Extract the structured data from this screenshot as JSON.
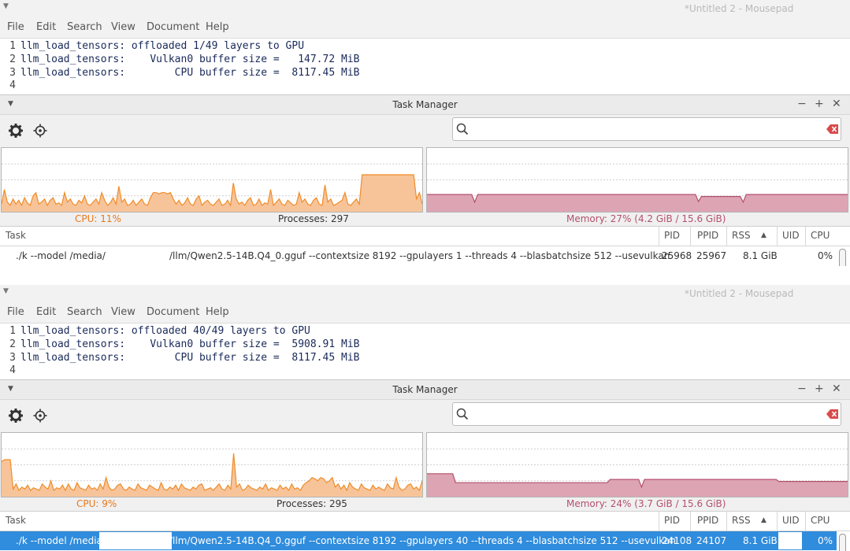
{
  "panels": [
    {
      "mousepad": {
        "title": "*Untitled 2 - Mousepad",
        "menu": [
          "File",
          "Edit",
          "Search",
          "View",
          "Document",
          "Help"
        ],
        "lines": [
          {
            "n": "1",
            "text": "llm_load_tensors: offloaded 1/49 layers to GPU"
          },
          {
            "n": "2",
            "text": "llm_load_tensors:    Vulkan0 buffer size =   147.72 MiB"
          },
          {
            "n": "3",
            "text": "llm_load_tensors:        CPU buffer size =  8117.45 MiB"
          },
          {
            "n": "4",
            "text": ""
          }
        ]
      },
      "taskmanager": {
        "title": "Task Manager",
        "search_value": "",
        "cpu_label": "CPU: 11%",
        "processes_label": "Processes: 297",
        "memory_label": "Memory: 27% (4.2 GiB / 15.6 GiB)",
        "columns": {
          "task": "Task",
          "pid": "PID",
          "ppid": "PPID",
          "rss": "RSS",
          "uid": "UID",
          "cpu": "CPU"
        },
        "row": {
          "task_a": "./k --model /media/",
          "task_b": "/llm/Qwen2.5-14B.Q4_0.gguf --contextsize 8192 --gpulayers 1 --threads 4 --blasbatchsize 512 --usevulkan",
          "pid": "25968",
          "ppid": "25967",
          "rss": "8.1 GiB",
          "uid": "",
          "cpu": "0%",
          "selected": false
        },
        "cpu_history": [
          0.12,
          0.35,
          0.15,
          0.1,
          0.2,
          0.12,
          0.18,
          0.1,
          0.22,
          0.14,
          0.1,
          0.25,
          0.3,
          0.12,
          0.15,
          0.2,
          0.1,
          0.18,
          0.22,
          0.12,
          0.14,
          0.1,
          0.3,
          0.15,
          0.2,
          0.12,
          0.1,
          0.18,
          0.14,
          0.25,
          0.12,
          0.1,
          0.15,
          0.2,
          0.12,
          0.3,
          0.18,
          0.1,
          0.14,
          0.22,
          0.12,
          0.4,
          0.15,
          0.2,
          0.1,
          0.12,
          0.18,
          0.1,
          0.15,
          0.2,
          0.12,
          0.1,
          0.22,
          0.3,
          0.3,
          0.28,
          0.3,
          0.3,
          0.28,
          0.3,
          0.2,
          0.12,
          0.18,
          0.1,
          0.14,
          0.22,
          0.12,
          0.1,
          0.2,
          0.25,
          0.1,
          0.15,
          0.18,
          0.12,
          0.1,
          0.15,
          0.2,
          0.1,
          0.12,
          0.18,
          0.1,
          0.45,
          0.2,
          0.12,
          0.15,
          0.1,
          0.18,
          0.22,
          0.1,
          0.12,
          0.2,
          0.1,
          0.14,
          0.12,
          0.35,
          0.1,
          0.15,
          0.2,
          0.12,
          0.1,
          0.18,
          0.14,
          0.1,
          0.12,
          0.3,
          0.15,
          0.2,
          0.12,
          0.1,
          0.18,
          0.22,
          0.12,
          0.1,
          0.42,
          0.15,
          0.2,
          0.1,
          0.12,
          0.15,
          0.18,
          0.3,
          0.12,
          0.1,
          0.15,
          0.2,
          0.12,
          0.58,
          0.58,
          0.58,
          0.58,
          0.58,
          0.58,
          0.58,
          0.58,
          0.58,
          0.58,
          0.58,
          0.58,
          0.58,
          0.58,
          0.58,
          0.58,
          0.58,
          0.58,
          0.58,
          0.2,
          0.3,
          0.12
        ],
        "mem_history": [
          0.27,
          0.27,
          0.27,
          0.27,
          0.27,
          0.27,
          0.27,
          0.27,
          0.27,
          0.27,
          0.27,
          0.27,
          0.27,
          0.27,
          0.27,
          0.27,
          0.15,
          0.27,
          0.27,
          0.27,
          0.27,
          0.27,
          0.27,
          0.27,
          0.27,
          0.27,
          0.27,
          0.27,
          0.27,
          0.27,
          0.27,
          0.27,
          0.27,
          0.27,
          0.27,
          0.27,
          0.27,
          0.27,
          0.27,
          0.27,
          0.27,
          0.27,
          0.27,
          0.27,
          0.27,
          0.27,
          0.27,
          0.27,
          0.27,
          0.27,
          0.27,
          0.27,
          0.27,
          0.27,
          0.27,
          0.27,
          0.27,
          0.27,
          0.27,
          0.27,
          0.27,
          0.27,
          0.27,
          0.27,
          0.27,
          0.27,
          0.27,
          0.27,
          0.27,
          0.27,
          0.27,
          0.27,
          0.27,
          0.27,
          0.27,
          0.27,
          0.27,
          0.27,
          0.27,
          0.27,
          0.27,
          0.27,
          0.27,
          0.27,
          0.27,
          0.27,
          0.27,
          0.27,
          0.27,
          0.27,
          0.27,
          0.16,
          0.24,
          0.24,
          0.24,
          0.24,
          0.24,
          0.24,
          0.24,
          0.24,
          0.24,
          0.24,
          0.24,
          0.24,
          0.24,
          0.24,
          0.15,
          0.27,
          0.27,
          0.27,
          0.27,
          0.27,
          0.27,
          0.27,
          0.27,
          0.27,
          0.27,
          0.27,
          0.27,
          0.27,
          0.27,
          0.27,
          0.27,
          0.27,
          0.27,
          0.27,
          0.27,
          0.27,
          0.27,
          0.27,
          0.27,
          0.27,
          0.27,
          0.27,
          0.27,
          0.27,
          0.27,
          0.27,
          0.27,
          0.27,
          0.27,
          0.27
        ]
      }
    },
    {
      "mousepad": {
        "title": "*Untitled 2 - Mousepad",
        "menu": [
          "File",
          "Edit",
          "Search",
          "View",
          "Document",
          "Help"
        ],
        "lines": [
          {
            "n": "1",
            "text": "llm_load_tensors: offloaded 40/49 layers to GPU"
          },
          {
            "n": "2",
            "text": "llm_load_tensors:    Vulkan0 buffer size =  5908.91 MiB"
          },
          {
            "n": "3",
            "text": "llm_load_tensors:        CPU buffer size =  8117.45 MiB"
          },
          {
            "n": "4",
            "text": ""
          }
        ]
      },
      "taskmanager": {
        "title": "Task Manager",
        "search_value": "",
        "cpu_label": "CPU: 9%",
        "processes_label": "Processes: 295",
        "memory_label": "Memory: 24% (3.7 GiB / 15.6 GiB)",
        "columns": {
          "task": "Task",
          "pid": "PID",
          "ppid": "PPID",
          "rss": "RSS",
          "uid": "UID",
          "cpu": "CPU"
        },
        "row": {
          "task_a": "./k --model /media/",
          "task_b": "/llm/Qwen2.5-14B.Q4_0.gguf --contextsize 8192 --gpulayers 40 --threads 4 --blasbatchsize 512 --usevulkan",
          "pid": "24108",
          "ppid": "24107",
          "rss": "8.1 GiB",
          "uid": "",
          "cpu": "0%",
          "selected": true
        },
        "cpu_history": [
          0.55,
          0.58,
          0.58,
          0.58,
          0.12,
          0.2,
          0.1,
          0.15,
          0.12,
          0.18,
          0.1,
          0.14,
          0.12,
          0.1,
          0.2,
          0.15,
          0.12,
          0.25,
          0.1,
          0.14,
          0.12,
          0.18,
          0.1,
          0.2,
          0.12,
          0.1,
          0.22,
          0.14,
          0.12,
          0.1,
          0.18,
          0.12,
          0.14,
          0.1,
          0.2,
          0.12,
          0.3,
          0.15,
          0.1,
          0.12,
          0.18,
          0.2,
          0.12,
          0.1,
          0.15,
          0.12,
          0.1,
          0.2,
          0.14,
          0.12,
          0.1,
          0.18,
          0.15,
          0.12,
          0.1,
          0.22,
          0.12,
          0.1,
          0.15,
          0.12,
          0.18,
          0.1,
          0.2,
          0.14,
          0.12,
          0.1,
          0.15,
          0.12,
          0.18,
          0.2,
          0.1,
          0.12,
          0.14,
          0.1,
          0.15,
          0.2,
          0.12,
          0.1,
          0.18,
          0.12,
          0.68,
          0.15,
          0.2,
          0.1,
          0.12,
          0.18,
          0.14,
          0.12,
          0.1,
          0.15,
          0.12,
          0.2,
          0.1,
          0.14,
          0.12,
          0.1,
          0.18,
          0.12,
          0.15,
          0.1,
          0.2,
          0.12,
          0.14,
          0.1,
          0.18,
          0.22,
          0.25,
          0.3,
          0.28,
          0.25,
          0.3,
          0.28,
          0.22,
          0.25,
          0.3,
          0.15,
          0.2,
          0.12,
          0.18,
          0.1,
          0.22,
          0.15,
          0.12,
          0.1,
          0.2,
          0.14,
          0.12,
          0.1,
          0.18,
          0.12,
          0.15,
          0.12,
          0.1,
          0.2,
          0.14,
          0.12,
          0.3,
          0.15,
          0.1,
          0.12,
          0.18,
          0.2,
          0.12,
          0.15,
          0.1,
          0.25
        ],
        "mem_history": [
          0.36,
          0.36,
          0.36,
          0.36,
          0.36,
          0.36,
          0.36,
          0.36,
          0.36,
          0.36,
          0.22,
          0.22,
          0.22,
          0.22,
          0.22,
          0.22,
          0.22,
          0.22,
          0.22,
          0.22,
          0.22,
          0.22,
          0.22,
          0.22,
          0.22,
          0.22,
          0.22,
          0.22,
          0.22,
          0.22,
          0.22,
          0.22,
          0.22,
          0.22,
          0.22,
          0.22,
          0.22,
          0.22,
          0.22,
          0.22,
          0.22,
          0.22,
          0.22,
          0.22,
          0.22,
          0.22,
          0.22,
          0.22,
          0.22,
          0.22,
          0.22,
          0.22,
          0.22,
          0.22,
          0.22,
          0.22,
          0.22,
          0.22,
          0.22,
          0.22,
          0.22,
          0.22,
          0.22,
          0.22,
          0.27,
          0.27,
          0.27,
          0.27,
          0.27,
          0.27,
          0.27,
          0.27,
          0.27,
          0.27,
          0.27,
          0.15,
          0.27,
          0.27,
          0.27,
          0.27,
          0.27,
          0.27,
          0.27,
          0.27,
          0.27,
          0.27,
          0.27,
          0.27,
          0.27,
          0.27,
          0.27,
          0.27,
          0.27,
          0.27,
          0.27,
          0.27,
          0.27,
          0.27,
          0.27,
          0.27,
          0.27,
          0.27,
          0.27,
          0.27,
          0.27,
          0.27,
          0.27,
          0.27,
          0.27,
          0.27,
          0.27,
          0.27,
          0.27,
          0.27,
          0.27,
          0.27,
          0.27,
          0.27,
          0.27,
          0.27,
          0.27,
          0.27,
          0.27,
          0.24,
          0.24,
          0.24,
          0.24,
          0.24,
          0.24,
          0.24,
          0.24,
          0.24,
          0.24,
          0.24,
          0.24,
          0.24,
          0.24,
          0.24,
          0.24,
          0.24,
          0.24,
          0.24,
          0.24,
          0.24,
          0.24,
          0.24,
          0.24,
          0.24
        ]
      }
    }
  ],
  "colors": {
    "cpu_line": "#f08c28",
    "cpu_fill": "#f7c49a",
    "mem_line": "#b4506e",
    "mem_fill": "#dda4b4",
    "selection": "#308cdc"
  }
}
